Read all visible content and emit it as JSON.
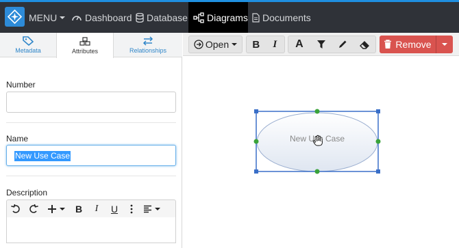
{
  "nav": {
    "menu_label": "MENU",
    "dashboard_label": "Dashboard",
    "database_label": "Database",
    "diagrams_label": "Diagrams",
    "documents_label": "Documents"
  },
  "tabs": [
    {
      "label": "Metadata",
      "icon": "tag-icon"
    },
    {
      "label": "Attributes",
      "icon": "cubes-icon",
      "active": true
    },
    {
      "label": "Relationships",
      "icon": "exchange-icon"
    }
  ],
  "form": {
    "number_label": "Number",
    "number_value": "",
    "name_label": "Name",
    "name_value": "New Use Case",
    "description_label": "Description"
  },
  "toolbar": {
    "open_label": "Open",
    "remove_label": "Remove"
  },
  "canvas": {
    "shape_label": "New Use Case"
  },
  "colors": {
    "topbar": "#2f3238",
    "accent": "#1f8fe0",
    "danger": "#d9534f",
    "selection": "#3a6fc8",
    "handle_green": "#3aa33a"
  }
}
